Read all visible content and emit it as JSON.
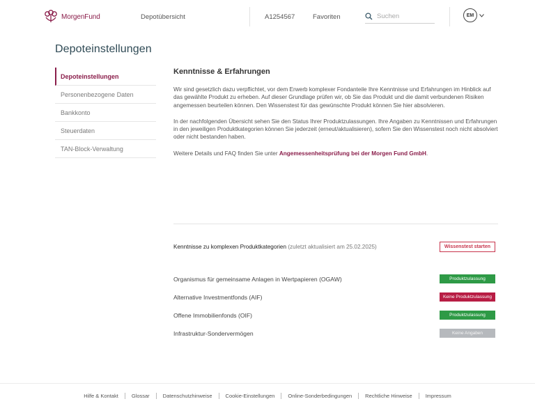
{
  "header": {
    "brand": "MorgenFund",
    "nav_depot": "Depotübersicht",
    "account_number": "A1254567",
    "favorites": "Favoriten",
    "search_placeholder": "Suchen",
    "avatar_initials": "EM",
    "brand_color": "#8a1d4a"
  },
  "page": {
    "title": "Depoteinstellungen"
  },
  "sidebar": {
    "items": [
      {
        "label": "Depoteinstellungen",
        "active": true
      },
      {
        "label": "Personenbezogene Daten"
      },
      {
        "label": "Bankkonto"
      },
      {
        "label": "Steuerdaten"
      },
      {
        "label": "TAN-Block-Verwaltung"
      }
    ]
  },
  "main": {
    "section_title": "Kenntnisse & Erfahrungen",
    "para1": "Wir sind gesetzlich dazu verpflichtet, vor dem Erwerb komplexer Fondanteile Ihre Kenntnisse und Erfahrungen im Hinblick auf das gewählte Produkt zu erheben. Auf dieser Grundlage prüfen wir, ob Sie das Produkt und die damit verbundenen Risiken angemessen beurteilen können. Den Wissenstest für das gewünschte Produkt können Sie hier absolvieren.",
    "para2": "In der nachfolgenden Übersicht sehen Sie den Status Ihrer Produktzulassungen. Ihre Angaben zu Kenntnissen und Erfahrungen in den jeweiligen Produktkategorien können Sie jederzeit (erneut/aktualisieren), sofern Sie den Wissenstest noch nicht absolviert oder nicht bestanden haben.",
    "para3_prefix": "Weitere Details und FAQ finden Sie unter ",
    "para3_link": "Angemessenheitsprüfung bei der Morgen Fund GmbH",
    "para3_suffix": "."
  },
  "status": {
    "heading": "Kenntnisse zu komplexen Produktkategorien",
    "date_note": "(zuletzt aktualisiert am 25.02.2025)",
    "test_button": "Wissenstest starten",
    "rows": [
      {
        "label": "Organismus für gemeinsame Anlagen in Wertpapieren (OGAW)",
        "badge": "Produktzulassung",
        "state": "green"
      },
      {
        "label": "Alternative Investmentfonds (AIF)",
        "badge": "Keine Produktzulassung",
        "state": "red"
      },
      {
        "label": "Offene Immobilienfonds (OIF)",
        "badge": "Produktzulassung",
        "state": "green"
      },
      {
        "label": "Infrastruktur-Sondervermögen",
        "badge": "Keine Angaben",
        "state": "gray"
      }
    ],
    "colors": {
      "green": "#2e9a46",
      "red": "#b81d44",
      "gray": "#b6b9bd"
    }
  },
  "footer": {
    "links": [
      "Hilfe & Kontakt",
      "Glossar",
      "Datenschutzhinweise",
      "Cookie-Einstellungen",
      "Online-Sonderbedingungen",
      "Rechtliche Hinweise",
      "Impressum"
    ]
  }
}
